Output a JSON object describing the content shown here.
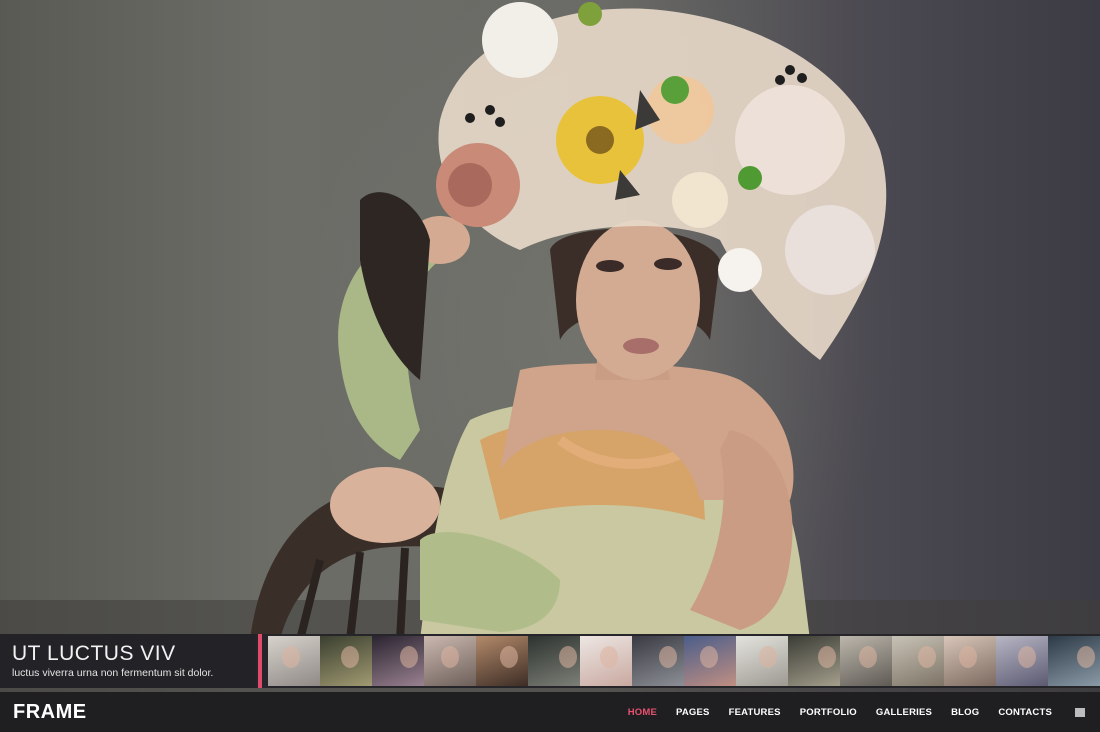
{
  "hero": {
    "slide_title": "UT LUCTUS VIV",
    "slide_subtitle": "luctus viverra urna non fermentum sit dolor."
  },
  "colors": {
    "accent": "#e04b6b",
    "nav_background": "#1f1f22",
    "strip_background": "#26262a"
  },
  "thumbnails": [
    {
      "name": "thumb-1",
      "colors": [
        "#d8d2cc",
        "#8f8a86"
      ]
    },
    {
      "name": "thumb-2",
      "colors": [
        "#3a3f2f",
        "#a19a72"
      ]
    },
    {
      "name": "thumb-3",
      "colors": [
        "#2a2430",
        "#9a8190"
      ]
    },
    {
      "name": "thumb-4",
      "colors": [
        "#cbb9b0",
        "#6d5f5a"
      ]
    },
    {
      "name": "thumb-5",
      "colors": [
        "#b38a6a",
        "#3d2d26"
      ]
    },
    {
      "name": "thumb-6",
      "colors": [
        "#2e3330",
        "#7c7f76"
      ]
    },
    {
      "name": "thumb-7",
      "colors": [
        "#ede6e3",
        "#c9a9a0"
      ]
    },
    {
      "name": "thumb-8",
      "colors": [
        "#3a3b42",
        "#8d8f96"
      ]
    },
    {
      "name": "thumb-9",
      "colors": [
        "#4b5d8a",
        "#c08f82"
      ]
    },
    {
      "name": "thumb-10",
      "colors": [
        "#e3e3dd",
        "#9e9a92"
      ]
    },
    {
      "name": "thumb-11",
      "colors": [
        "#3b3d36",
        "#a49e8c"
      ]
    },
    {
      "name": "thumb-12",
      "colors": [
        "#bdb7ac",
        "#5f5b55"
      ]
    },
    {
      "name": "thumb-13",
      "colors": [
        "#c8c2b6",
        "#7d7466"
      ]
    },
    {
      "name": "thumb-14",
      "colors": [
        "#d9c6b9",
        "#7c6a60"
      ]
    },
    {
      "name": "thumb-15",
      "colors": [
        "#b7b6c4",
        "#5c5a72"
      ]
    },
    {
      "name": "thumb-16",
      "colors": [
        "#2c3a46",
        "#8a9aa6"
      ]
    }
  ],
  "nav": {
    "logo": "FRAME",
    "items": [
      {
        "label": "HOME",
        "active": true
      },
      {
        "label": "PAGES",
        "active": false
      },
      {
        "label": "FEATURES",
        "active": false
      },
      {
        "label": "PORTFOLIO",
        "active": false
      },
      {
        "label": "GALLERIES",
        "active": false
      },
      {
        "label": "BLOG",
        "active": false
      },
      {
        "label": "CONTACTS",
        "active": false
      }
    ],
    "menu_icon": "grid-menu-icon"
  }
}
